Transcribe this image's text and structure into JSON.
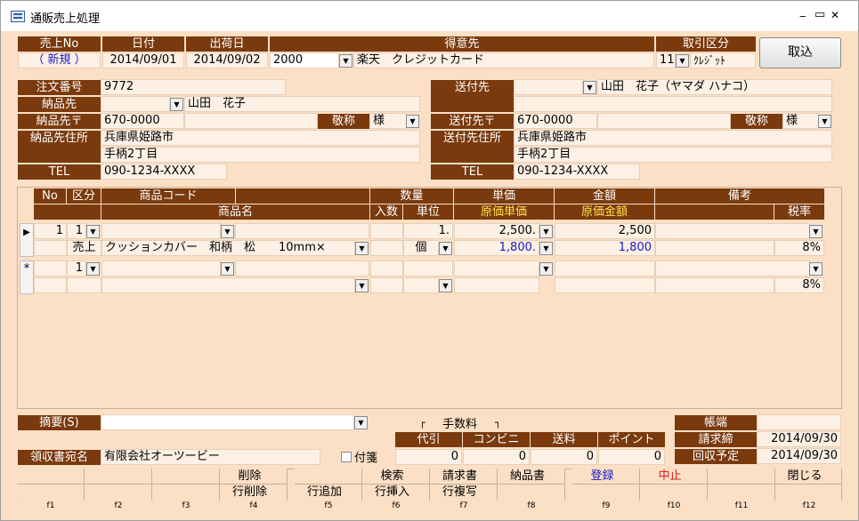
{
  "window": {
    "title": "通販売上処理",
    "minimize": "‒",
    "restore": "▭",
    "close": "✕"
  },
  "header": {
    "labels": {
      "sale_no": "売上No",
      "date": "日付",
      "ship_date": "出荷日",
      "customer": "得意先",
      "trade_type": "取引区分"
    },
    "sale_no": "（ 新規 ）",
    "date": "2014/09/01",
    "ship_date": "2014/09/02",
    "customer_code": "2000",
    "customer_name": "楽天　クレジットカード",
    "trade_code": "11",
    "trade_name": "ｸﾚｼﾞｯﾄ",
    "import_button": "取込"
  },
  "delivery": {
    "labels": {
      "order_no": "注文番号",
      "dest": "納品先",
      "zip": "納品先〒",
      "honorific": "敬称",
      "address": "納品先住所",
      "tel": "TEL"
    },
    "order_no": "9772",
    "dest_name": "山田　花子",
    "zip": "670-0000",
    "honorific": "様",
    "address1": "兵庫県姫路市",
    "address2": "手柄2丁目",
    "tel": "090-1234-XXXX"
  },
  "shipto": {
    "labels": {
      "dest": "送付先",
      "zip": "送付先〒",
      "honorific": "敬称",
      "address": "送付先住所",
      "tel": "TEL"
    },
    "dest_name": "山田　花子（ヤマダ ハナコ）",
    "zip": "670-0000",
    "honorific": "様",
    "address1": "兵庫県姫路市",
    "address2": "手柄2丁目",
    "tel": "090-1234-XXXX"
  },
  "grid": {
    "headers": {
      "no": "No",
      "kubun": "区分",
      "code": "商品コード",
      "qty": "数量",
      "price": "単価",
      "amount": "金額",
      "note": "備考",
      "name": "商品名",
      "irisu": "入数",
      "unit": "単位",
      "cost_price": "原価単価",
      "cost_amount": "原価金額",
      "tax": "税率"
    },
    "rows": [
      {
        "no": "1",
        "kubun": "1",
        "kubun_label": "売上",
        "name": "クッションカバー　和柄　松　　10mm×",
        "qty": "1.",
        "unit": "個",
        "price": "2,500.",
        "amount": "2,500",
        "cost_price": "1,800.",
        "cost_amount": "1,800",
        "tax": "8%"
      },
      {
        "no": "",
        "kubun": "1",
        "kubun_label": "",
        "name": "",
        "qty": "",
        "unit": "",
        "price": "",
        "amount": "",
        "cost_price": "",
        "cost_amount": "",
        "tax": "8%"
      }
    ]
  },
  "summary": {
    "label": "摘要(S)",
    "value": ""
  },
  "fee": {
    "title": "手数料",
    "labels": [
      "代引",
      "コンビニ",
      "送料",
      "ポイント"
    ],
    "values": [
      "0",
      "0",
      "0",
      "0"
    ]
  },
  "ledger": {
    "title": "帳端",
    "labels": {
      "billing": "請求締",
      "collect": "回収予定"
    },
    "billing": "2014/09/30",
    "collect": "2014/09/30"
  },
  "receipt": {
    "label": "領収書宛名",
    "value": "有限会社オーツービー",
    "tag_label": "付箋"
  },
  "fkeys": [
    {
      "key": "f1",
      "top": "",
      "bottom": ""
    },
    {
      "key": "f2",
      "top": "",
      "bottom": ""
    },
    {
      "key": "f3",
      "top": "",
      "bottom": ""
    },
    {
      "key": "f4",
      "top": "削除",
      "bottom": "行削除"
    },
    {
      "key": "f5",
      "top": "",
      "bottom": "行追加"
    },
    {
      "key": "f6",
      "top": "検索",
      "bottom": "行挿入"
    },
    {
      "key": "f7",
      "top": "請求書",
      "bottom": "行複写"
    },
    {
      "key": "f8",
      "top": "納品書",
      "bottom": ""
    },
    {
      "key": "f9",
      "top": "登録",
      "bottom": ""
    },
    {
      "key": "f10",
      "top": "中止",
      "bottom": ""
    },
    {
      "key": "f11",
      "top": "",
      "bottom": ""
    },
    {
      "key": "f12",
      "top": "閉じる",
      "bottom": ""
    }
  ],
  "colors": {
    "header_bg": "#7a3a0e",
    "form_bg": "#fbe0c6",
    "cell_bg": "#fdf0e4",
    "accent_yellow": "#ffe14a",
    "register_blue": "#1a1ac8",
    "cancel_red": "#e02020"
  }
}
